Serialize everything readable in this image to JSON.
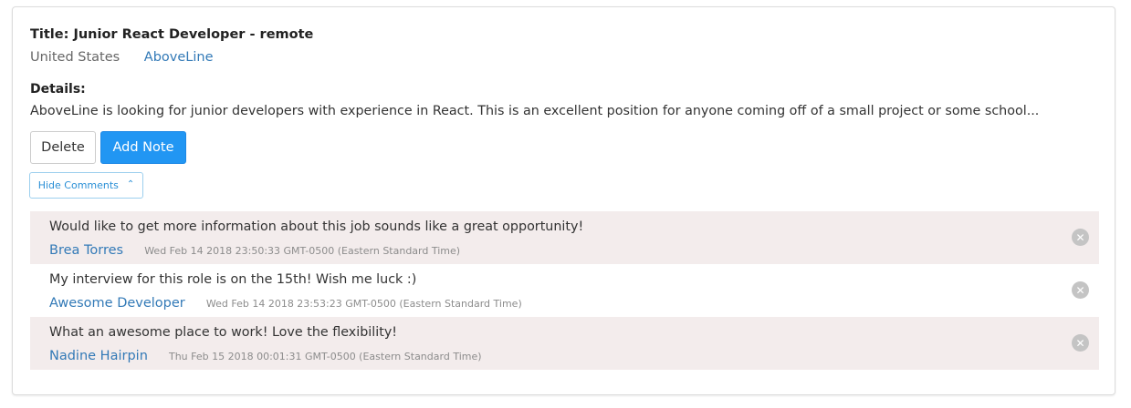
{
  "job": {
    "title_line": "Title: Junior React Developer - remote",
    "location": "United States",
    "company": "AboveLine",
    "details_label": "Details:",
    "details_text": "AboveLine is looking for junior developers with experience in React. This is an excellent position for anyone coming off of a small project or some school..."
  },
  "actions": {
    "delete_label": "Delete",
    "add_note_label": "Add Note",
    "toggle_comments_label": "Hide Comments",
    "toggle_icon": "chevron-up-icon"
  },
  "comments": [
    {
      "text": "Would like to get more information about this job sounds like a great opportunity!",
      "author": "Brea Torres",
      "date": "Wed Feb 14 2018 23:50:33 GMT-0500 (Eastern Standard Time)"
    },
    {
      "text": "My interview for this role is on the 15th! Wish me luck :)",
      "author": "Awesome Developer",
      "date": "Wed Feb 14 2018 23:53:23 GMT-0500 (Eastern Standard Time)"
    },
    {
      "text": "What an awesome place to work! Love the flexibility!",
      "author": "Nadine Hairpin",
      "date": "Thu Feb 15 2018 00:01:31 GMT-0500 (Eastern Standard Time)"
    }
  ],
  "colors": {
    "primary_button": "#2196f3",
    "link": "#337ab7",
    "comment_shade": "#f3ecec"
  }
}
